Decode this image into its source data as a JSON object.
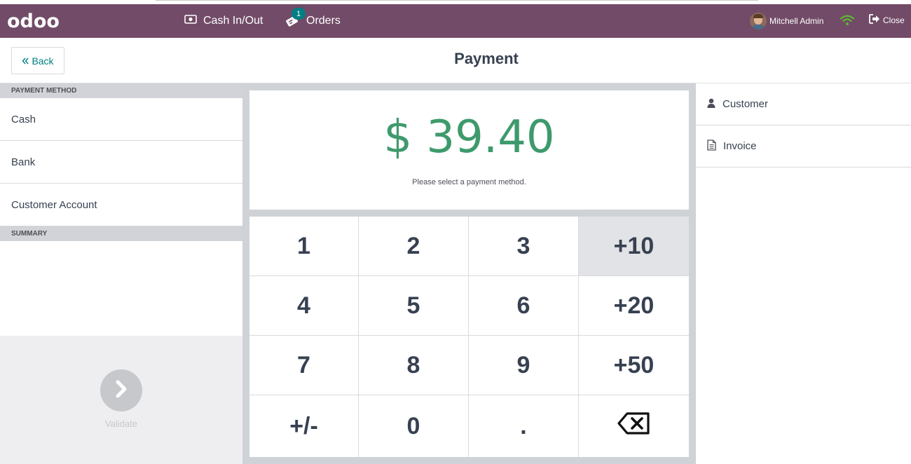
{
  "navbar": {
    "logo": "odoo",
    "cash_label": "Cash In/Out",
    "orders_label": "Orders",
    "orders_badge": "1",
    "user_name": "Mitchell Admin",
    "close_label": "Close"
  },
  "header": {
    "back_label": "Back",
    "title": "Payment"
  },
  "left": {
    "payment_method_heading": "PAYMENT METHOD",
    "methods": [
      {
        "label": "Cash"
      },
      {
        "label": "Bank"
      },
      {
        "label": "Customer Account"
      }
    ],
    "summary_heading": "SUMMARY",
    "validate_label": "Validate"
  },
  "center": {
    "amount": "$ 39.40",
    "message": "Please select a payment method.",
    "keys": [
      "1",
      "2",
      "3",
      "+10",
      "4",
      "5",
      "6",
      "+20",
      "7",
      "8",
      "9",
      "+50",
      "+/-",
      "0",
      "."
    ]
  },
  "right": {
    "customer_label": "Customer",
    "invoice_label": "Invoice"
  },
  "colors": {
    "brand": "#714b67",
    "accent": "#017e84",
    "amount": "#3e9a6c",
    "wifi": "#5fb832"
  }
}
